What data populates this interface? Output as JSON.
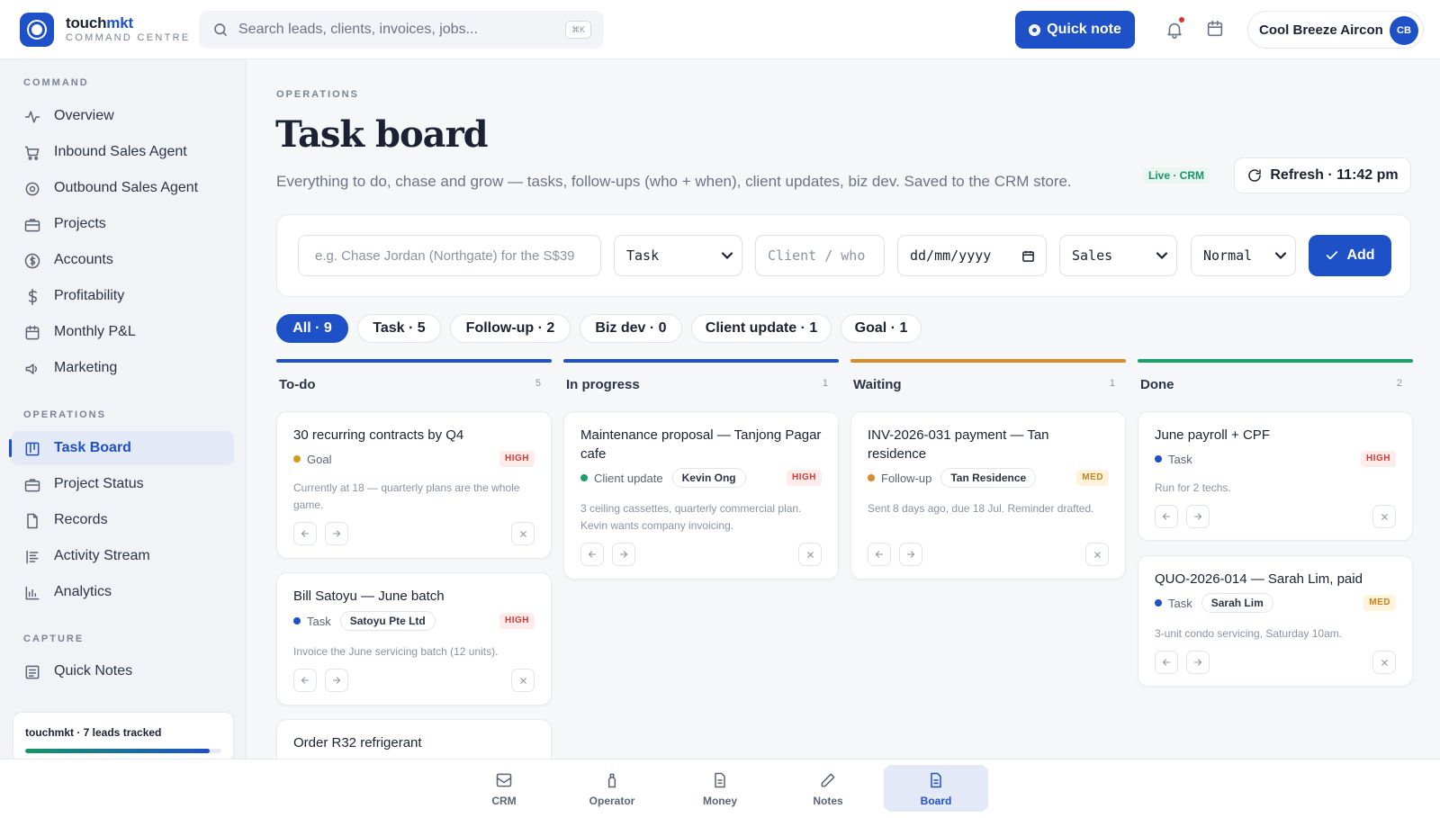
{
  "app": {
    "brand_main": "touch",
    "brand_accent": "mkt",
    "brand_sub": "COMMAND CENTRE"
  },
  "search": {
    "placeholder": "Search leads, clients, invoices, jobs...",
    "shortcut": "⌘K"
  },
  "header": {
    "quick_note": "Quick note",
    "account_name": "Cool Breeze Aircon",
    "avatar_initials": "CB"
  },
  "sidebar": {
    "sections": [
      {
        "label": "COMMAND",
        "items": [
          "Overview",
          "Inbound Sales Agent",
          "Outbound Sales Agent",
          "Projects",
          "Accounts",
          "Profitability",
          "Monthly P&L",
          "Marketing"
        ]
      },
      {
        "label": "OPERATIONS",
        "items": [
          "Task Board",
          "Project Status",
          "Records",
          "Activity Stream",
          "Analytics"
        ]
      },
      {
        "label": "CAPTURE",
        "items": [
          "Quick Notes"
        ]
      }
    ],
    "active": "Task Board",
    "leads_label": "touchmkt · 7 leads tracked",
    "leads_progress": 0.94
  },
  "page": {
    "breadcrumb": "OPERATIONS",
    "title": "Task board",
    "subtitle": "Everything to do, chase and grow — tasks, follow-ups (who + when), client updates, biz dev. Saved to the CRM store.",
    "live_badge": "Live · CRM",
    "refresh_label": "Refresh · 11:42 pm"
  },
  "form": {
    "text_placeholder": "e.g. Chase Jordan (Northgate) for the S$39",
    "type_value": "Task",
    "client_placeholder": "Client / who",
    "date_placeholder": "dd/mm/yyyy",
    "category_value": "Sales",
    "priority_value": "Normal",
    "add_label": "Add"
  },
  "filters": [
    "All · 9",
    "Task · 5",
    "Follow-up · 2",
    "Biz dev · 0",
    "Client update · 1",
    "Goal · 1"
  ],
  "columns": [
    {
      "title": "To-do",
      "count": "5",
      "color": "#1e50c8"
    },
    {
      "title": "In progress",
      "count": "1",
      "color": "#1e50c8"
    },
    {
      "title": "Waiting",
      "count": "1",
      "color": "#d98a2b"
    },
    {
      "title": "Done",
      "count": "2",
      "color": "#17a26a"
    }
  ],
  "cards": {
    "todo": [
      {
        "title": "30 recurring contracts by Q4",
        "type": "Goal",
        "type_color": "#d39a1c",
        "priority": "HIGH",
        "desc": "Currently at 18 — quarterly plans are the whole game."
      },
      {
        "title": "Bill Satoyu — June batch",
        "type": "Task",
        "type_color": "#1e50c8",
        "client": "Satoyu Pte Ltd",
        "priority": "HIGH",
        "desc": "Invoice the June servicing batch (12 units)."
      },
      {
        "title": "Order R32 refrigerant"
      }
    ],
    "inprogress": [
      {
        "title": "Maintenance proposal — Tanjong Pagar cafe",
        "type": "Client update",
        "type_color": "#17a26a",
        "client": "Kevin Ong",
        "priority": "HIGH",
        "desc": "3 ceiling cassettes, quarterly commercial plan. Kevin wants company invoicing."
      }
    ],
    "waiting": [
      {
        "title": "INV-2026-031 payment — Tan residence",
        "type": "Follow-up",
        "type_color": "#d98a2b",
        "client": "Tan Residence",
        "priority": "MED",
        "desc": "Sent 8 days ago, due 18 Jul. Reminder drafted."
      }
    ],
    "done": [
      {
        "title": "June payroll + CPF",
        "type": "Task",
        "type_color": "#1e50c8",
        "priority": "HIGH",
        "desc": "Run for 2 techs."
      },
      {
        "title": "QUO-2026-014 — Sarah Lim, paid",
        "type": "Task",
        "type_color": "#1e50c8",
        "client": "Sarah Lim",
        "priority": "MED",
        "desc": "3-unit condo servicing, Saturday 10am."
      }
    ]
  },
  "bottom_nav": [
    "CRM",
    "Operator",
    "Money",
    "Notes",
    "Board"
  ],
  "bottom_active": "Board"
}
